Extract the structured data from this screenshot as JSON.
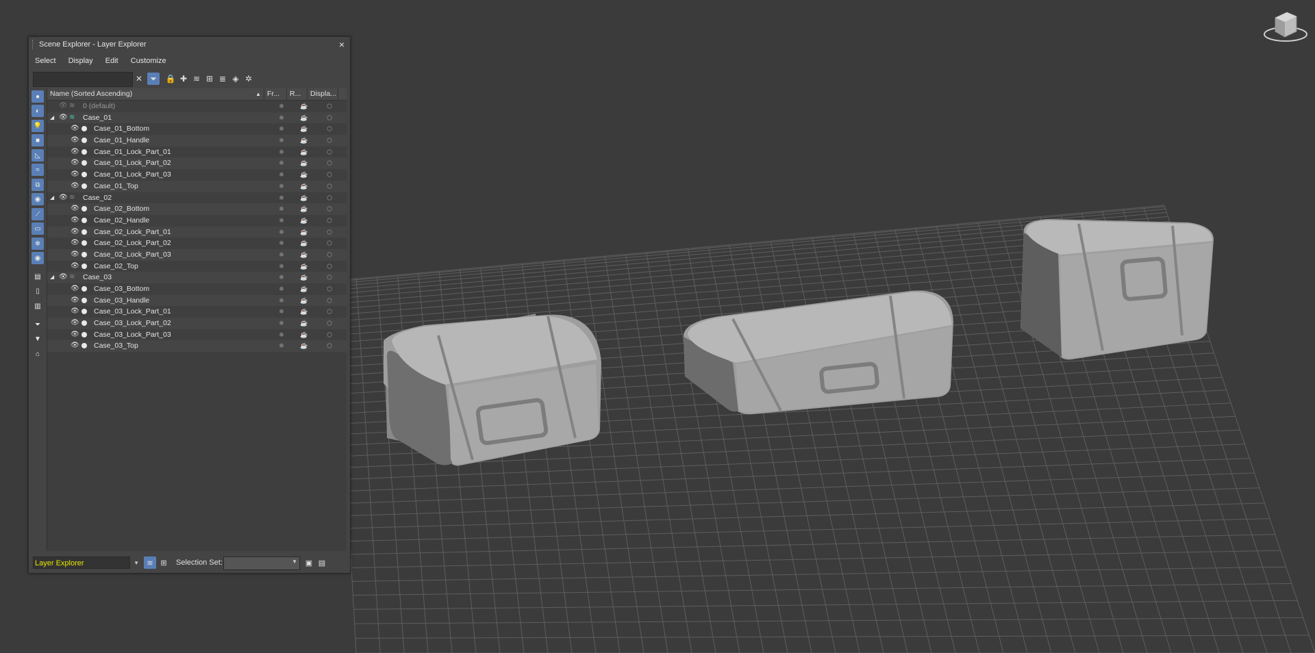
{
  "panel": {
    "title": "Scene Explorer - Layer Explorer",
    "close_label": "×",
    "menu": [
      "Select",
      "Display",
      "Edit",
      "Customize"
    ],
    "search_placeholder": "",
    "clear_label": "✕",
    "columns": [
      "Name (Sorted Ascending)",
      "Fr...",
      "R...",
      "Displa..."
    ],
    "sort_indicator": "▲"
  },
  "tree_rows": [
    {
      "name": "0 (default)",
      "level": 0,
      "kind": "default-layer"
    },
    {
      "name": "Case_01",
      "level": 0,
      "kind": "active-layer"
    },
    {
      "name": "Case_01_Bottom",
      "level": 1,
      "kind": "object"
    },
    {
      "name": "Case_01_Handle",
      "level": 1,
      "kind": "object"
    },
    {
      "name": "Case_01_Lock_Part_01",
      "level": 1,
      "kind": "object"
    },
    {
      "name": "Case_01_Lock_Part_02",
      "level": 1,
      "kind": "object"
    },
    {
      "name": "Case_01_Lock_Part_03",
      "level": 1,
      "kind": "object"
    },
    {
      "name": "Case_01_Top",
      "level": 1,
      "kind": "object"
    },
    {
      "name": "Case_02",
      "level": 0,
      "kind": "layer"
    },
    {
      "name": "Case_02_Bottom",
      "level": 1,
      "kind": "object"
    },
    {
      "name": "Case_02_Handle",
      "level": 1,
      "kind": "object"
    },
    {
      "name": "Case_02_Lock_Part_01",
      "level": 1,
      "kind": "object"
    },
    {
      "name": "Case_02_Lock_Part_02",
      "level": 1,
      "kind": "object"
    },
    {
      "name": "Case_02_Lock_Part_03",
      "level": 1,
      "kind": "object"
    },
    {
      "name": "Case_02_Top",
      "level": 1,
      "kind": "object"
    },
    {
      "name": "Case_03",
      "level": 0,
      "kind": "layer"
    },
    {
      "name": "Case_03_Bottom",
      "level": 1,
      "kind": "object"
    },
    {
      "name": "Case_03_Handle",
      "level": 1,
      "kind": "object"
    },
    {
      "name": "Case_03_Lock_Part_01",
      "level": 1,
      "kind": "object"
    },
    {
      "name": "Case_03_Lock_Part_02",
      "level": 1,
      "kind": "object"
    },
    {
      "name": "Case_03_Lock_Part_03",
      "level": 1,
      "kind": "object"
    },
    {
      "name": "Case_03_Top",
      "level": 1,
      "kind": "object"
    }
  ],
  "bottom": {
    "explorer_value": "Layer Explorer",
    "selection_set_label": "Selection Set:",
    "selection_set_value": ""
  },
  "colors": {
    "viewport_bg": "#3b3b3b",
    "grid_line": "#6a6a6a",
    "accent": "#5a7fb6",
    "layer_icon": "#48c9b0",
    "combo_text": "#e8e800"
  }
}
